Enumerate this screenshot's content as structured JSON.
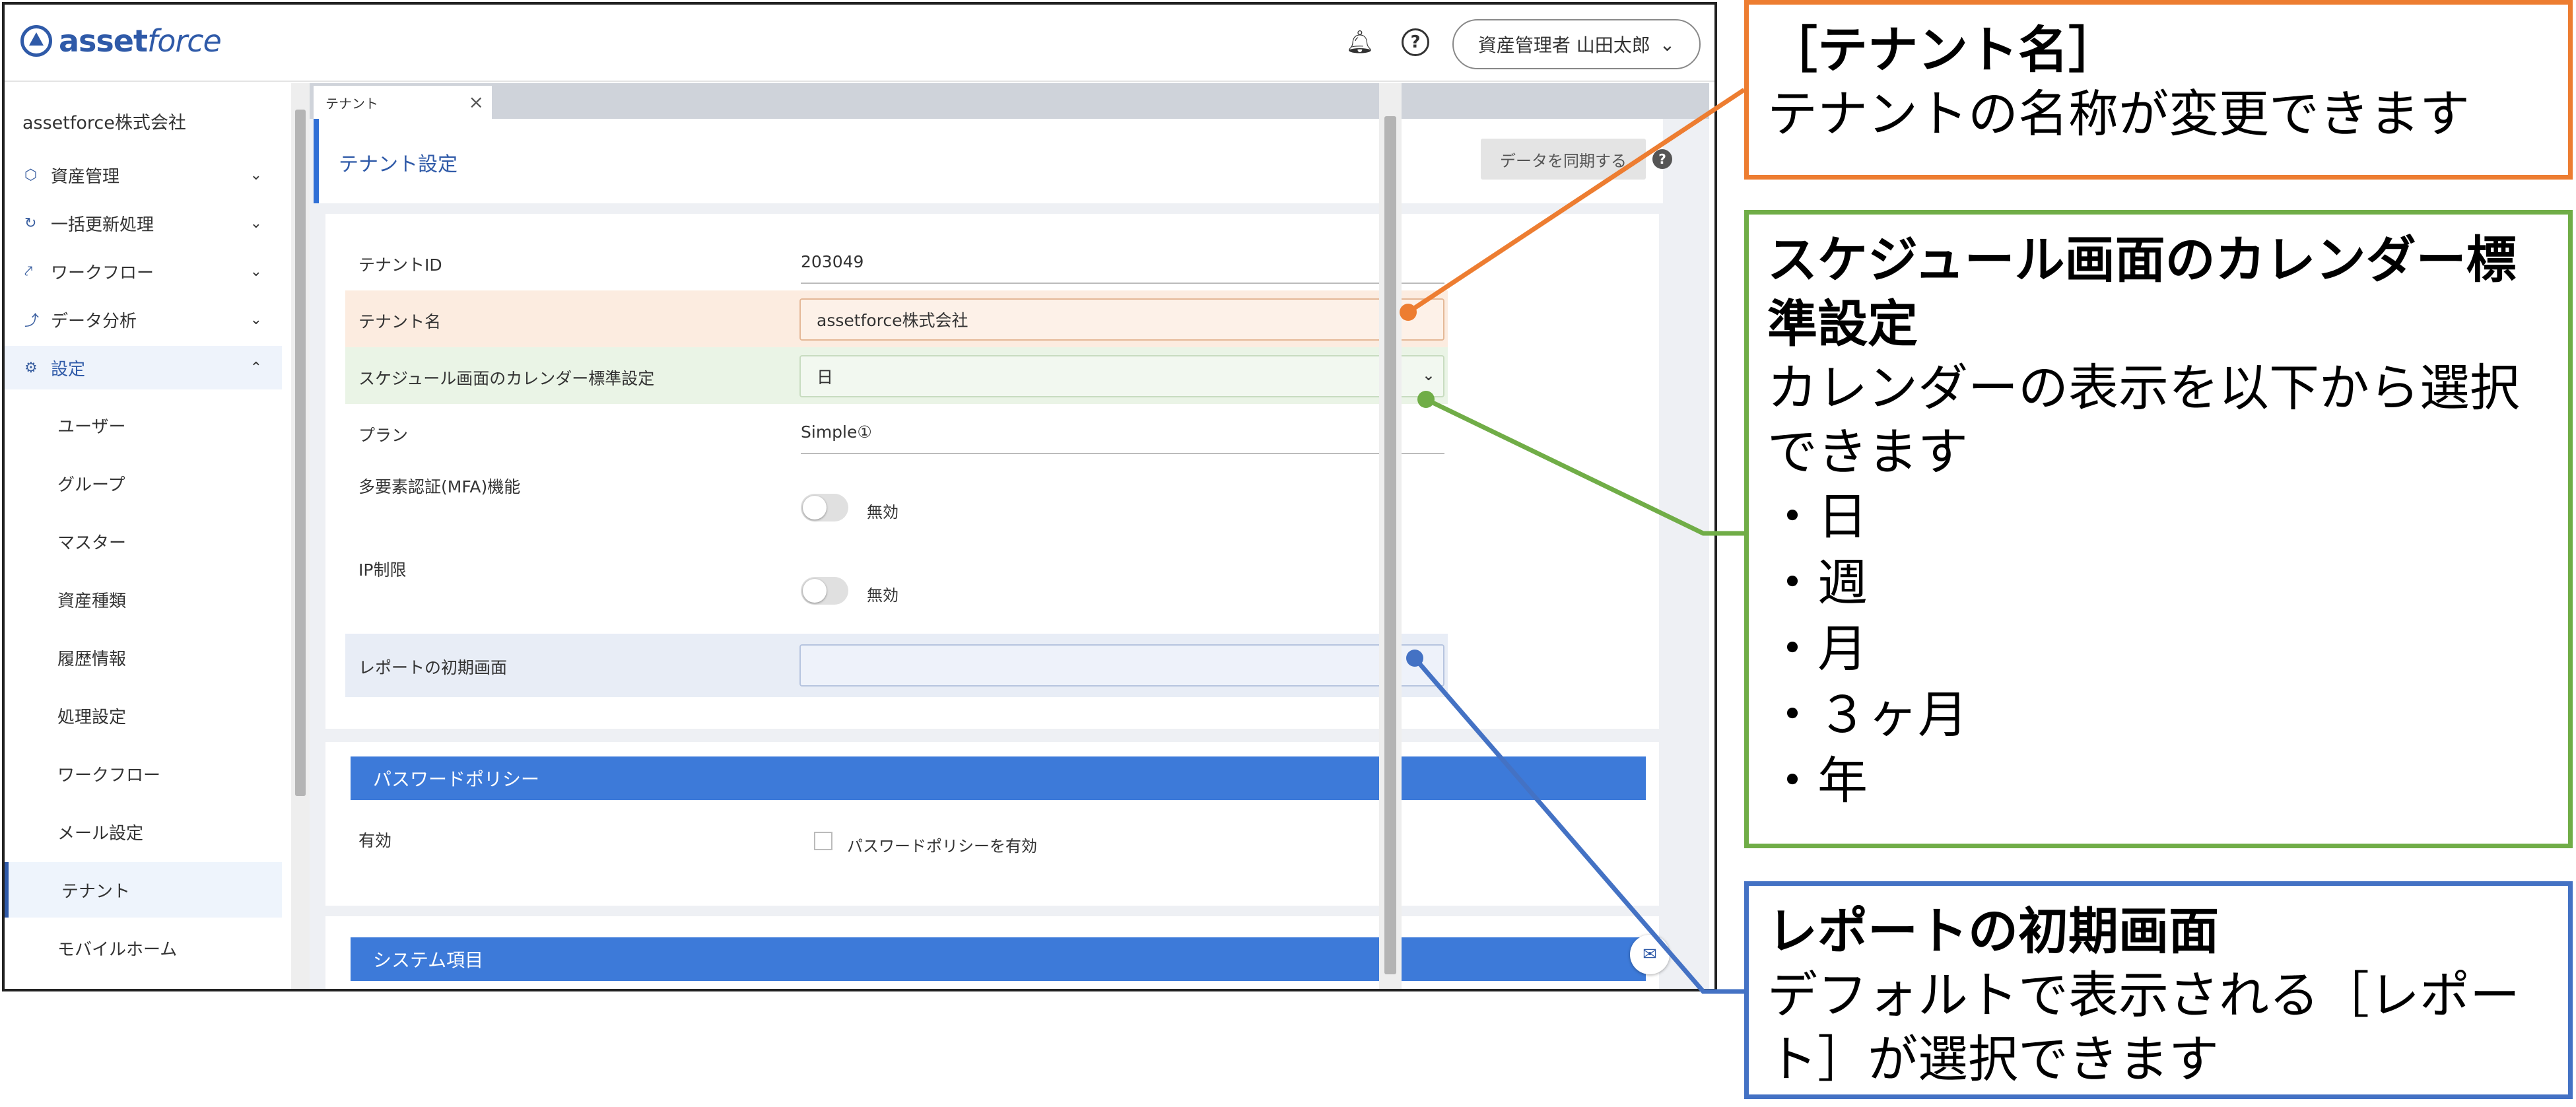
{
  "header": {
    "logo_text_1": "asset",
    "logo_text_2": "force",
    "user_menu": "資産管理者 山田太郎"
  },
  "sidebar": {
    "company": "assetforce株式会社",
    "items": [
      {
        "label": "資産管理"
      },
      {
        "label": "一括更新処理"
      },
      {
        "label": "ワークフロー"
      },
      {
        "label": "データ分析"
      },
      {
        "label": "設定"
      }
    ],
    "sub_items": [
      {
        "label": "ユーザー"
      },
      {
        "label": "グループ"
      },
      {
        "label": "マスター"
      },
      {
        "label": "資産種類"
      },
      {
        "label": "履歴情報"
      },
      {
        "label": "処理設定"
      },
      {
        "label": "ワークフロー"
      },
      {
        "label": "メール設定"
      },
      {
        "label": "テナント"
      },
      {
        "label": "モバイルホーム"
      }
    ]
  },
  "tab": {
    "label": "テナント"
  },
  "page": {
    "title": "テナント設定",
    "sync_button": "データを同期する"
  },
  "form": {
    "tenant_id_label": "テナントID",
    "tenant_id_value": "203049",
    "tenant_name_label": "テナント名",
    "tenant_name_value": "assetforce株式会社",
    "calendar_label": "スケジュール画面のカレンダー標準設定",
    "calendar_value": "日",
    "plan_label": "プラン",
    "plan_value": "Simple①",
    "mfa_label": "多要素認証(MFA)機能",
    "mfa_state": "無効",
    "ip_label": "IP制限",
    "ip_state": "無効",
    "report_label": "レポートの初期画面",
    "report_value": ""
  },
  "password": {
    "heading": "パスワードポリシー",
    "enabled_label": "有効",
    "checkbox_label": "パスワードポリシーを有効"
  },
  "system": {
    "heading": "システム項目"
  },
  "callouts": {
    "tenant": {
      "title": "［テナント名］",
      "body": "テナントの名称が変更できます"
    },
    "calendar": {
      "title": "スケジュール画面のカレンダー標準設定",
      "body": "カレンダーの表示を以下から選択できます",
      "options": [
        "・日",
        "・週",
        "・月",
        "・３ヶ月",
        "・年"
      ]
    },
    "report": {
      "title": "レポートの初期画面",
      "body": "デフォルトで表示される［レポート］が選択できます"
    }
  },
  "colors": {
    "orange": "#ed7d31",
    "green": "#70ad47",
    "blue": "#4472c4",
    "brand": "#2f5aa8",
    "section_blue": "#3d7ad9"
  }
}
